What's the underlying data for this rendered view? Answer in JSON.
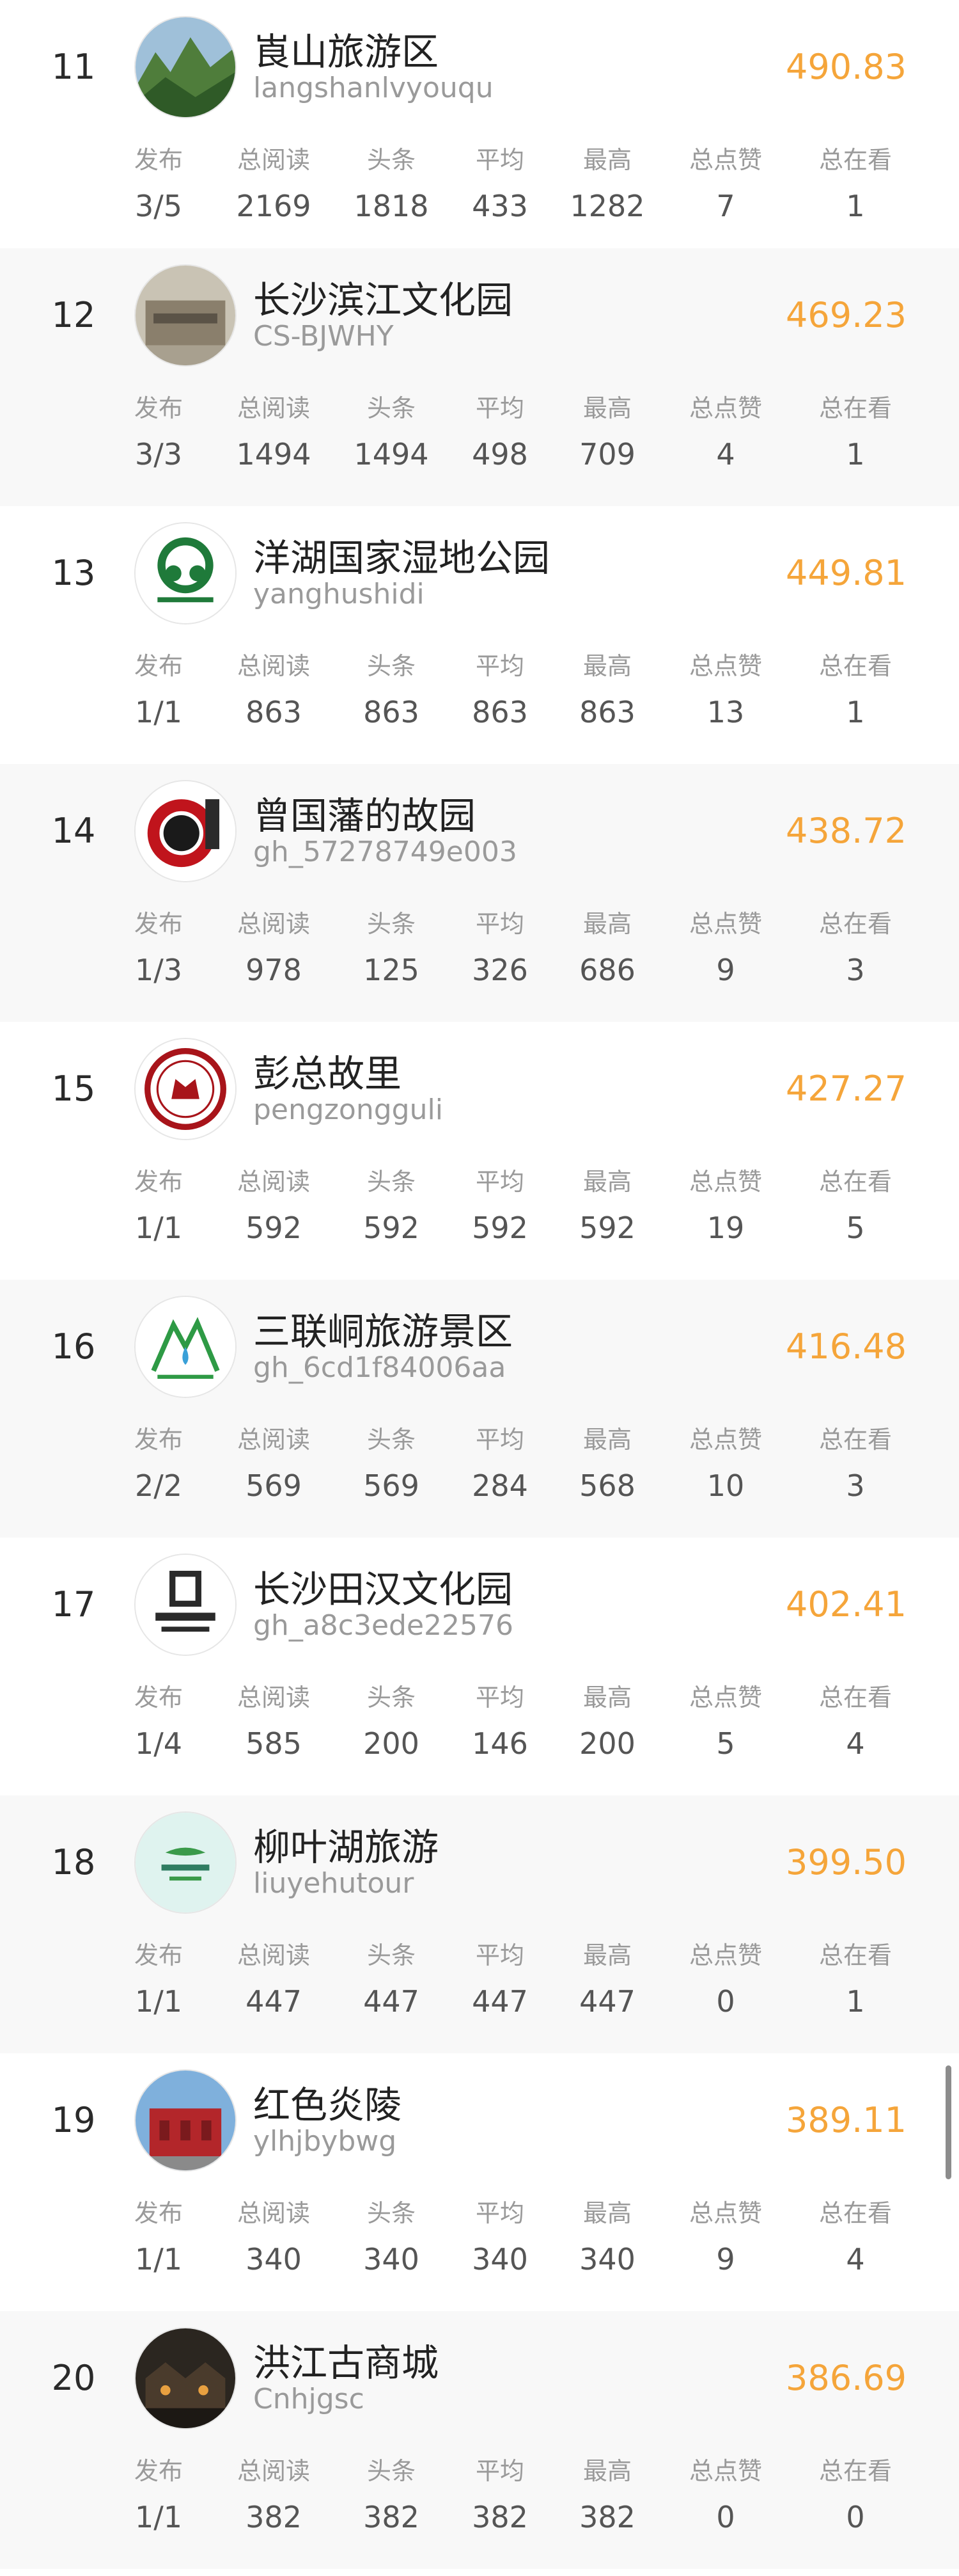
{
  "stat_labels": [
    "发布",
    "总阅读",
    "头条",
    "平均",
    "最高",
    "总点赞",
    "总在看"
  ],
  "colors": {
    "score": "#f5a53a",
    "alt_row_bg": "#f8f8f8"
  },
  "rows": [
    {
      "rank": "11",
      "name": "崀山旅游区",
      "account": "langshanlvyouqu",
      "score": "490.83",
      "avatar_icon": "mountain-landscape-icon",
      "stats": [
        "3/5",
        "2169",
        "1818",
        "433",
        "1282",
        "7",
        "1"
      ]
    },
    {
      "rank": "12",
      "name": "长沙滨江文化园",
      "account": "CS-BJWHY",
      "score": "469.23",
      "avatar_icon": "building-facade-icon",
      "stats": [
        "3/3",
        "1494",
        "1494",
        "498",
        "709",
        "4",
        "1"
      ]
    },
    {
      "rank": "13",
      "name": "洋湖国家湿地公园",
      "account": "yanghushidi",
      "score": "449.81",
      "avatar_icon": "wetland-logo-icon",
      "stats": [
        "1/1",
        "863",
        "863",
        "863",
        "863",
        "13",
        "1"
      ]
    },
    {
      "rank": "14",
      "name": "曾国藩的故园",
      "account": "gh_57278749e003",
      "score": "438.72",
      "avatar_icon": "red-circle-logo-icon",
      "stats": [
        "1/3",
        "978",
        "125",
        "326",
        "686",
        "9",
        "3"
      ]
    },
    {
      "rank": "15",
      "name": "彭总故里",
      "account": "pengzongguli",
      "score": "427.27",
      "avatar_icon": "scenic-seal-logo-icon",
      "stats": [
        "1/1",
        "592",
        "592",
        "592",
        "592",
        "19",
        "5"
      ]
    },
    {
      "rank": "16",
      "name": "三联峒旅游景区",
      "account": "gh_6cd1f84006aa",
      "score": "416.48",
      "avatar_icon": "green-mountain-logo-icon",
      "stats": [
        "2/2",
        "569",
        "569",
        "284",
        "568",
        "10",
        "3"
      ]
    },
    {
      "rank": "17",
      "name": "长沙田汉文化园",
      "account": "gh_a8c3ede22576",
      "score": "402.41",
      "avatar_icon": "tianhan-logo-icon",
      "stats": [
        "1/4",
        "585",
        "200",
        "146",
        "200",
        "5",
        "4"
      ]
    },
    {
      "rank": "18",
      "name": "柳叶湖旅游",
      "account": "liuyehutour",
      "score": "399.50",
      "avatar_icon": "lake-logo-icon",
      "stats": [
        "1/1",
        "447",
        "447",
        "447",
        "447",
        "0",
        "1"
      ]
    },
    {
      "rank": "19",
      "name": "红色炎陵",
      "account": "ylhjbybwg",
      "score": "389.11",
      "avatar_icon": "red-museum-icon",
      "stats": [
        "1/1",
        "340",
        "340",
        "340",
        "340",
        "9",
        "4"
      ]
    },
    {
      "rank": "20",
      "name": "洪江古商城",
      "account": "Cnhjgsc",
      "score": "386.69",
      "avatar_icon": "old-town-night-icon",
      "stats": [
        "1/1",
        "382",
        "382",
        "382",
        "382",
        "0",
        "0"
      ]
    }
  ]
}
